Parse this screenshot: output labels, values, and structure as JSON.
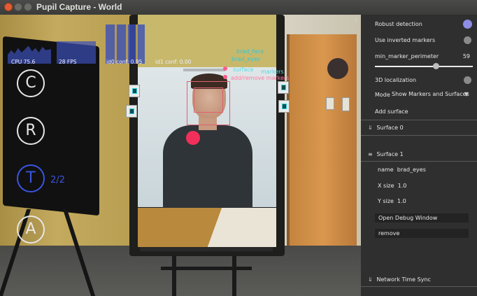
{
  "window": {
    "title": "Pupil Capture - World"
  },
  "stats": {
    "cpu": "CPU 75.6",
    "fps": "28 FPS",
    "id0": "id0 conf: 0.95",
    "id1": "id1 conf: 0.00"
  },
  "modes": {
    "c": "C",
    "r": "R",
    "t": "T",
    "t_count": "2/2",
    "a": "A"
  },
  "overlay": {
    "surface_name_1": "brad_face",
    "surface_name_2": "brad_eyes",
    "surface_tag": "surface",
    "markers_tag": "markers",
    "add_remove": "add/remove markers"
  },
  "panel": {
    "robust_detection": {
      "label": "Robust detection",
      "on": true
    },
    "inverted_markers": {
      "label": "Use inverted markers",
      "on": false
    },
    "min_marker_perimeter": {
      "label": "min_marker_perimeter",
      "value": "59",
      "fraction": 0.62
    },
    "localization_3d": {
      "label": "3D localization",
      "on": false
    },
    "mode": {
      "label": "Mode",
      "value": "Show Markers and Surfaces"
    },
    "add_surface": "Add surface",
    "surface0": {
      "header": "Surface 0"
    },
    "surface1": {
      "header": "Surface 1",
      "name_label": "name",
      "name_value": "brad_eyes",
      "xsize_label": "X size",
      "xsize_value": "1.0",
      "ysize_label": "Y size",
      "ysize_value": "1.0",
      "open_debug": "Open Debug Window",
      "remove": "remove"
    },
    "network_time_sync": "Network Time Sync"
  },
  "colors": {
    "active_mode": "#3a55e0",
    "gaze": "#f0305a",
    "toggle_on": "#8e8ee6"
  }
}
